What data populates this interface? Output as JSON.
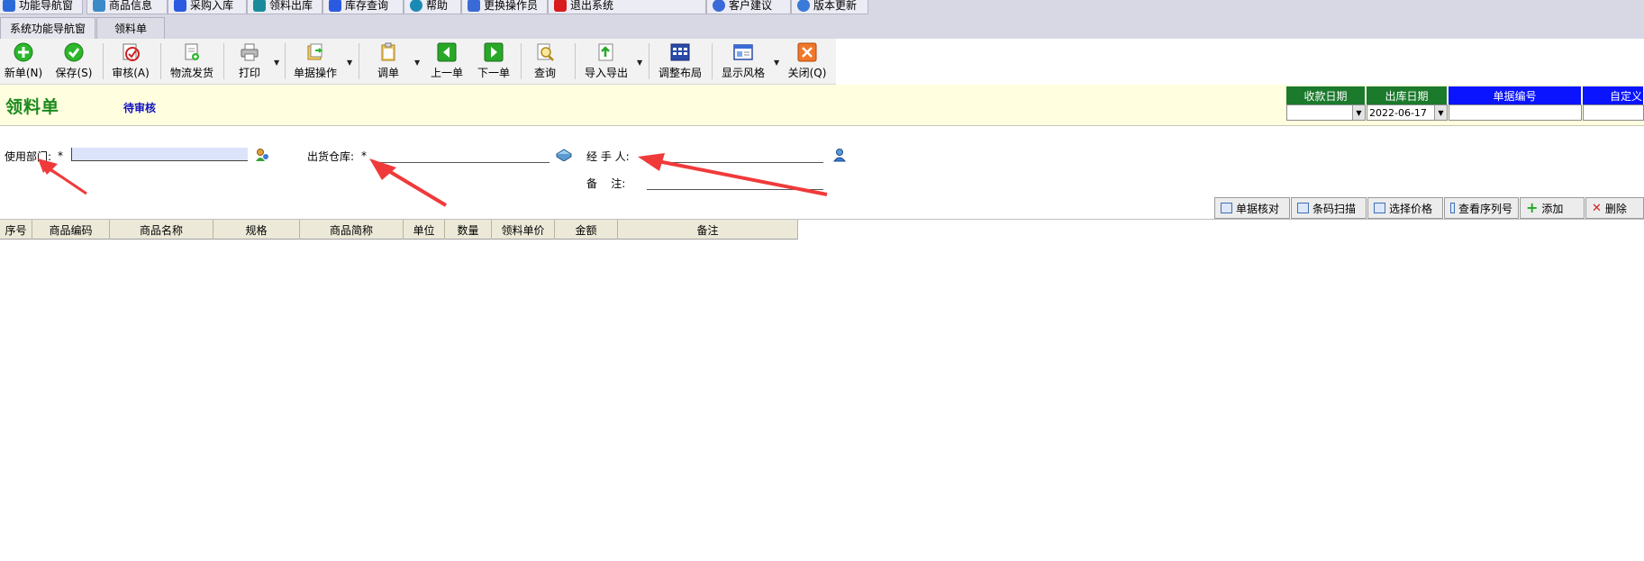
{
  "topnav": {
    "items": [
      {
        "label": "功能导航窗",
        "icon": "home-icon",
        "color": "#2a6ad8"
      },
      {
        "label": "商品信息",
        "icon": "product-info-icon",
        "color": "#3a8ac8"
      },
      {
        "label": "采购入库",
        "icon": "purchase-icon",
        "color": "#2a5ae0"
      },
      {
        "label": "领料出库",
        "icon": "requisition-out-icon",
        "color": "#1a8a9a"
      },
      {
        "label": "库存查询",
        "icon": "stock-query-icon",
        "color": "#2a5ae0"
      },
      {
        "label": "帮助",
        "icon": "help-icon",
        "color": "#1a8ab4"
      },
      {
        "label": "更换操作员",
        "icon": "switch-user-icon",
        "color": "#3a6ad8"
      },
      {
        "label": "退出系统",
        "icon": "exit-icon",
        "color": "#d81a1a"
      },
      {
        "label": "客户建议",
        "icon": "feedback-icon",
        "color": "#3a6ad8"
      },
      {
        "label": "版本更新",
        "icon": "update-icon",
        "color": "#3a7ad8"
      }
    ]
  },
  "tabs": [
    {
      "label": "系统功能导航窗",
      "active": false
    },
    {
      "label": "领料单",
      "active": true
    }
  ],
  "toolbar": {
    "new_label": "新单(N)",
    "save_label": "保存(S)",
    "audit_label": "审核(A)",
    "logistics_label": "物流发货",
    "print_label": "打印",
    "doc_ops_label": "单据操作",
    "transfer_label": "调单",
    "prev_label": "上一单",
    "next_label": "下一单",
    "query_label": "查询",
    "import_export_label": "导入导出",
    "layout_label": "调整布局",
    "style_label": "显示风格",
    "close_label": "关闭(Q)"
  },
  "form": {
    "title": "领料单",
    "status": "待审核",
    "dept_label": "使用部门:",
    "dept_required": "*",
    "dept_value": "",
    "warehouse_label": "出货仓库:",
    "warehouse_required": "*",
    "warehouse_value": "",
    "handler_label": "经 手 人:",
    "handler_value": "",
    "remark_label": "备    注:",
    "remark_value": ""
  },
  "header_fields": {
    "receipt_date_label": "收款日期",
    "receipt_date_value": "",
    "outbound_date_label": "出库日期",
    "outbound_date_value": "2022-06-17",
    "doc_number_label": "单据编号",
    "doc_number_value": "",
    "custom_label": "自定义",
    "custom_value": ""
  },
  "actions": {
    "verify_label": "单据核对",
    "barcode_label": "条码扫描",
    "price_label": "选择价格",
    "serial_label": "查看序列号",
    "add_label": "添加",
    "delete_label": "删除"
  },
  "grid": {
    "columns": [
      "序号",
      "商品编码",
      "商品名称",
      "规格",
      "商品简称",
      "单位",
      "数量",
      "领料单价",
      "金额",
      "备注"
    ],
    "rows": []
  },
  "colors": {
    "title_green": "#1b8a1b",
    "status_blue": "#1010c0",
    "header_green": "#1b7a2c",
    "header_blue": "#0a14ff",
    "annotation_red": "#f03a3a",
    "band_yellow": "#ffffe0"
  }
}
